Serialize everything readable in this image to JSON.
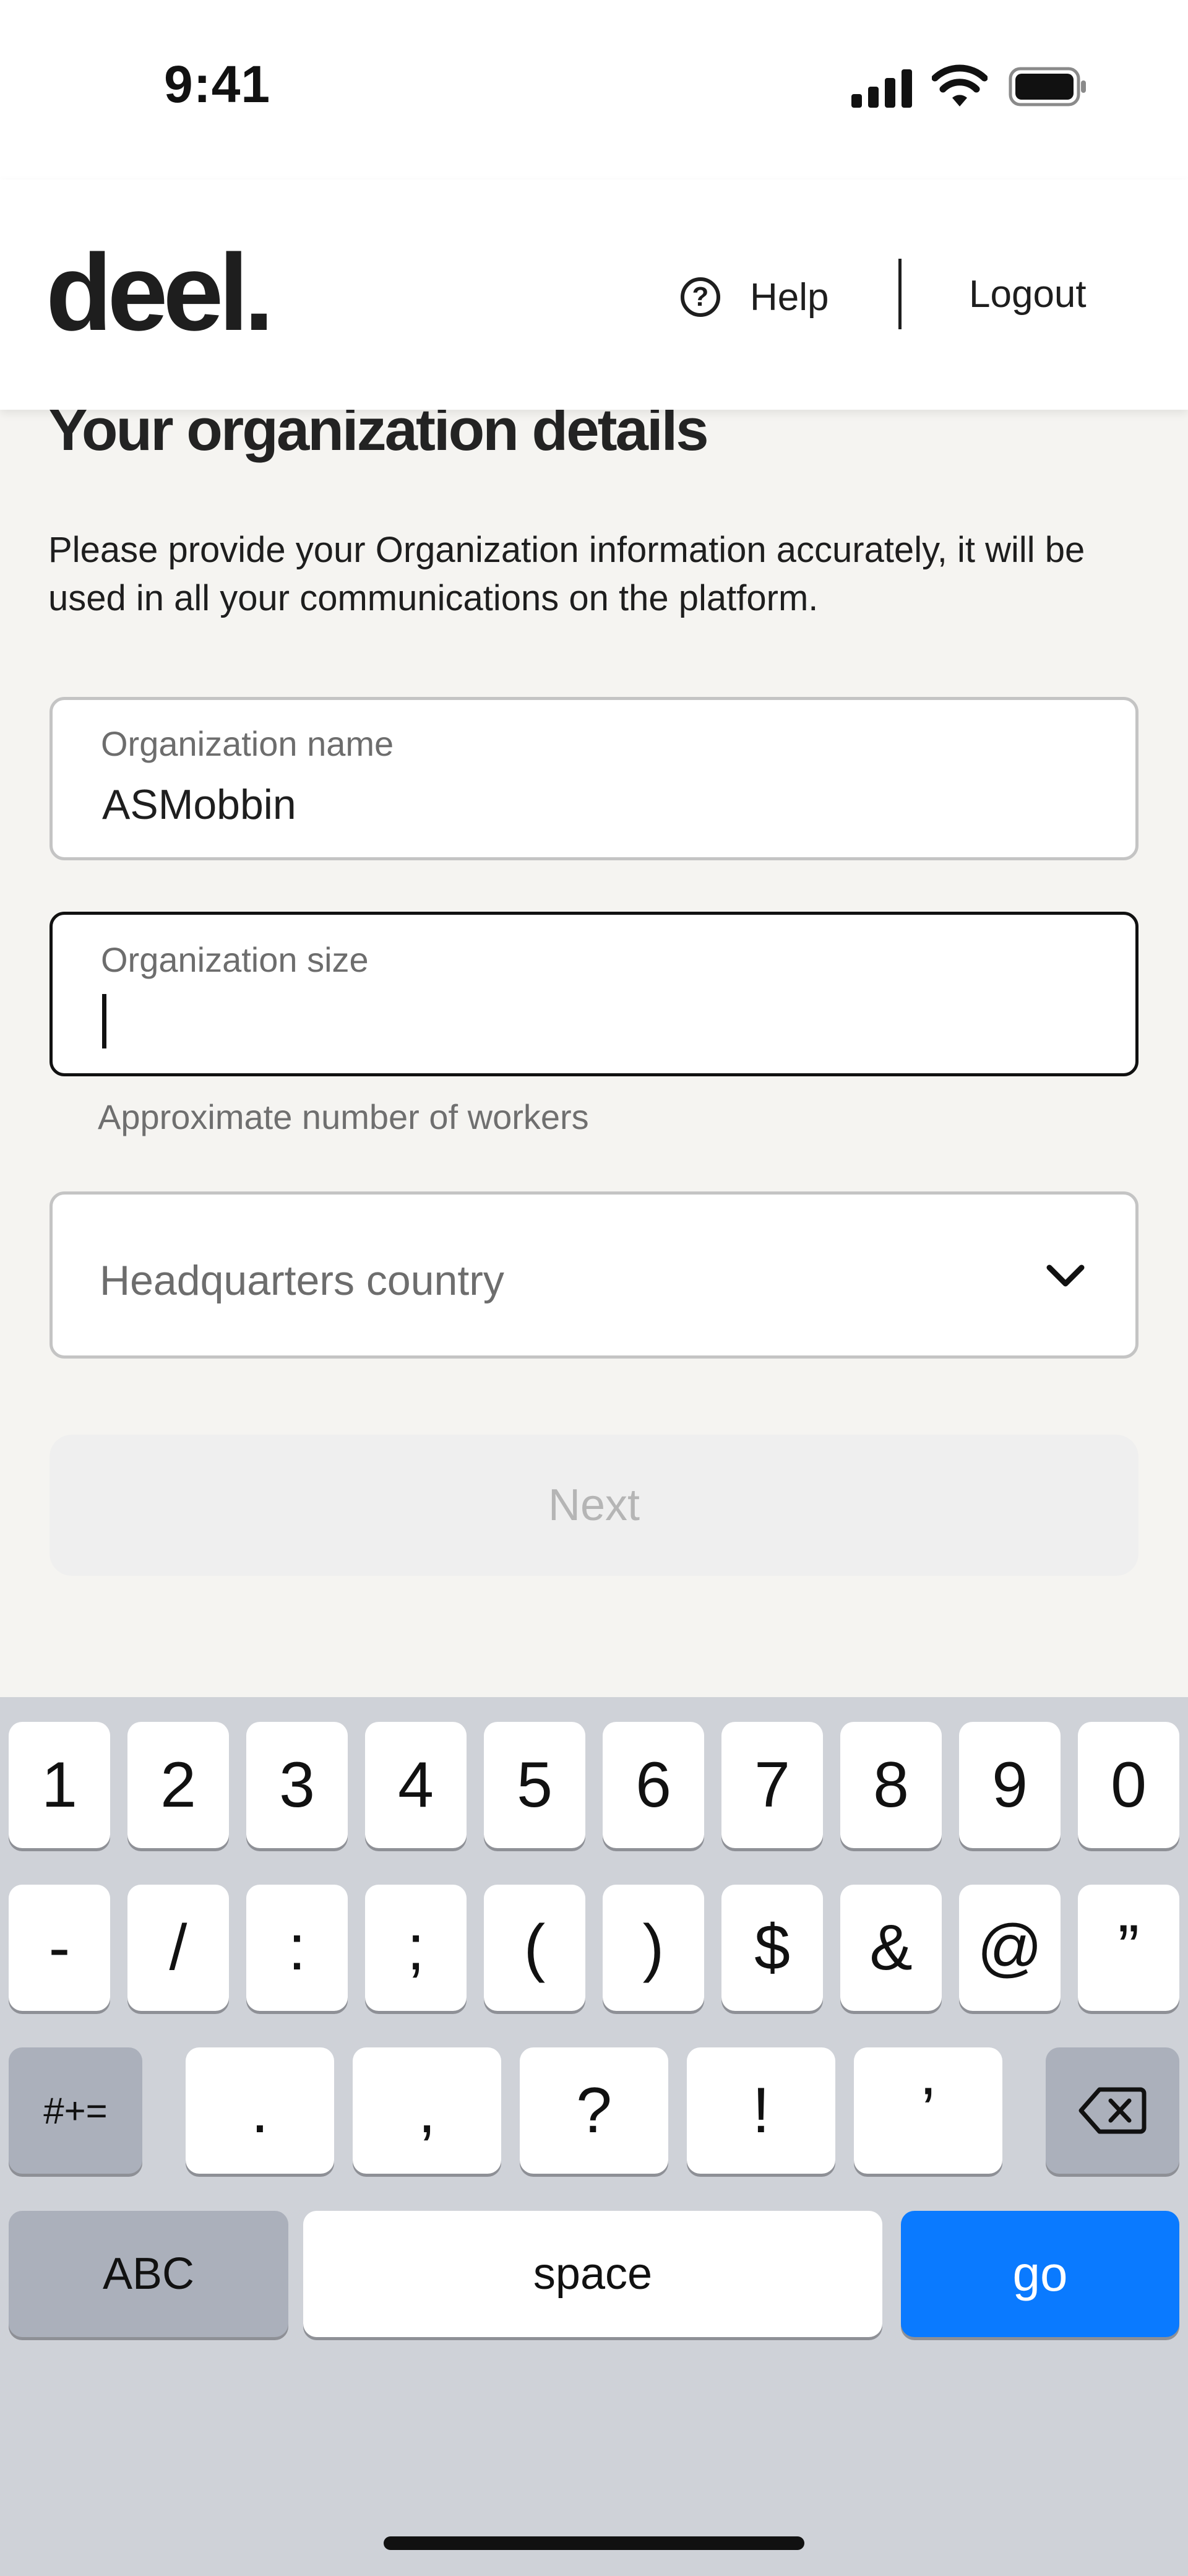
{
  "status_bar": {
    "time": "9:41"
  },
  "header": {
    "logo": "deel.",
    "help_label": "Help",
    "logout_label": "Logout"
  },
  "page": {
    "title": "Your organization details",
    "intro": "Please provide your Organization information accurately, it will be used in all your communications on the platform."
  },
  "form": {
    "org_name": {
      "label": "Organization name",
      "value": "ASMobbin"
    },
    "org_size": {
      "label": "Organization size",
      "value": "",
      "helper": "Approximate number of workers"
    },
    "country": {
      "placeholder": "Headquarters country"
    },
    "next_label": "Next"
  },
  "keyboard": {
    "row1": [
      "1",
      "2",
      "3",
      "4",
      "5",
      "6",
      "7",
      "8",
      "9",
      "0"
    ],
    "row2": [
      "-",
      "/",
      ":",
      ";",
      "(",
      ")",
      "$",
      "&",
      "@",
      "”"
    ],
    "row3": [
      "#+=",
      ".",
      ",",
      "?",
      "!",
      "’"
    ],
    "row4": [
      "ABC",
      "space",
      "go"
    ]
  },
  "colors": {
    "accent_go": "#0a7aff",
    "background": "#f5f4f1",
    "keyboard_bg": "#cfd2d8"
  },
  "icons": [
    "help-icon",
    "chevron-down-icon",
    "backspace-icon",
    "signal-icon",
    "wifi-icon",
    "battery-icon"
  ]
}
